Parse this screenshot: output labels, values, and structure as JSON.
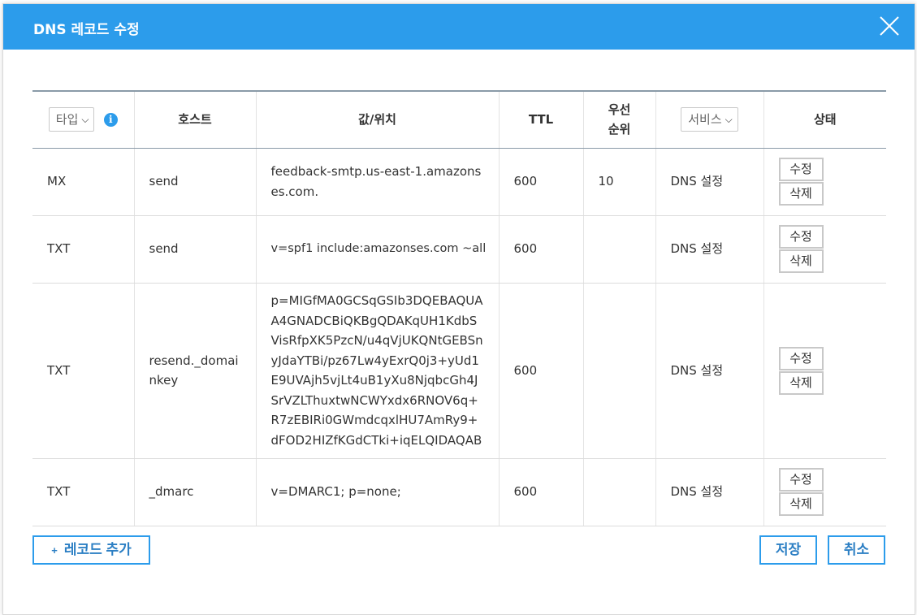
{
  "dialog": {
    "title": "DNS 레코드 수정",
    "close_icon": "close-icon"
  },
  "table": {
    "headers": {
      "type_select": "타입",
      "host": "호스트",
      "value": "값/위치",
      "ttl": "TTL",
      "priority_line1": "우선",
      "priority_line2": "순위",
      "service_select": "서비스",
      "status": "상태"
    },
    "rows": [
      {
        "type": "MX",
        "host": "send",
        "value": "feedback-smtp.us-east-1.amazonses.com.",
        "ttl": "600",
        "priority": "10",
        "service": "DNS 설정",
        "edit": "수정",
        "delete": "삭제"
      },
      {
        "type": "TXT",
        "host": "send",
        "value": "v=spf1 include:amazonses.com ~all",
        "ttl": "600",
        "priority": "",
        "service": "DNS 설정",
        "edit": "수정",
        "delete": "삭제"
      },
      {
        "type": "TXT",
        "host": "resend._domainkey",
        "value": "p=MIGfMA0GCSqGSIb3DQEBAQUAA4GNADCBiQKBgQDAKqUH1KdbSVisRfpXK5PzcN/u4qVjUKQNtGEBSnyJdaYTBi/pz67Lw4yExrQ0j3+yUd1E9UVAjh5vjLt4uB1yXu8NjqbcGh4JSrVZLThuxtwNCWYxdx6RNOV6q+R7zEBIRi0GWmdcqxlHU7AmRy9+dFOD2HIZfKGdCTki+iqELQIDAQAB",
        "ttl": "600",
        "priority": "",
        "service": "DNS 설정",
        "edit": "수정",
        "delete": "삭제"
      },
      {
        "type": "TXT",
        "host": "_dmarc",
        "value": "v=DMARC1; p=none;",
        "ttl": "600",
        "priority": "",
        "service": "DNS 설정",
        "edit": "수정",
        "delete": "삭제"
      }
    ]
  },
  "footer": {
    "add_record": "레코드 추가",
    "add_icon": "+",
    "save": "저장",
    "cancel": "취소"
  },
  "colors": {
    "header_bg": "#2c9ceb",
    "accent": "#2c7fc4"
  }
}
